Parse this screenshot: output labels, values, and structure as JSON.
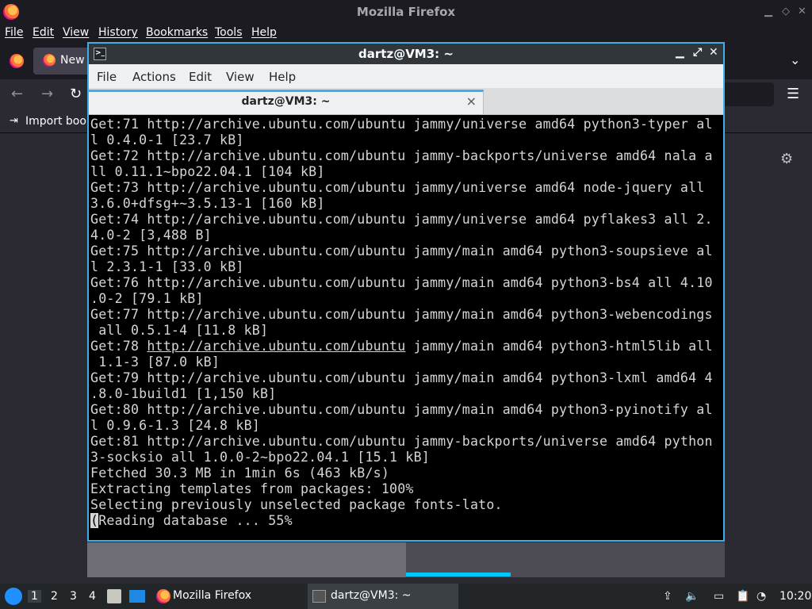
{
  "firefox": {
    "window_title": "Mozilla Firefox",
    "menu": [
      "File",
      "Edit",
      "View",
      "History",
      "Bookmarks",
      "Tools",
      "Help"
    ],
    "tab_label": "New",
    "bookmarks_import": "Import book",
    "settings_icon": "gear-icon"
  },
  "terminal": {
    "window_title": "dartz@VM3: ~",
    "menu": [
      "File",
      "Actions",
      "Edit",
      "View",
      "Help"
    ],
    "tab_title": "dartz@VM3: ~",
    "lines": [
      "Get:71 http://archive.ubuntu.com/ubuntu jammy/universe amd64 python3-typer al",
      "l 0.4.0-1 [23.7 kB]",
      "Get:72 http://archive.ubuntu.com/ubuntu jammy-backports/universe amd64 nala a",
      "ll 0.11.1~bpo22.04.1 [104 kB]",
      "Get:73 http://archive.ubuntu.com/ubuntu jammy/universe amd64 node-jquery all",
      "3.6.0+dfsg+~3.5.13-1 [160 kB]",
      "Get:74 http://archive.ubuntu.com/ubuntu jammy/universe amd64 pyflakes3 all 2.",
      "4.0-2 [3,488 B]",
      "Get:75 http://archive.ubuntu.com/ubuntu jammy/main amd64 python3-soupsieve al",
      "l 2.3.1-1 [33.0 kB]",
      "Get:76 http://archive.ubuntu.com/ubuntu jammy/main amd64 python3-bs4 all 4.10",
      ".0-2 [79.1 kB]",
      "Get:77 http://archive.ubuntu.com/ubuntu jammy/main amd64 python3-webencodings",
      " all 0.5.1-4 [11.8 kB]",
      "Get:78 ",
      " 1.1-3 [87.0 kB]",
      "Get:79 http://archive.ubuntu.com/ubuntu jammy/main amd64 python3-lxml amd64 4",
      ".8.0-1build1 [1,150 kB]",
      "Get:80 http://archive.ubuntu.com/ubuntu jammy/main amd64 python3-pyinotify al",
      "l 0.9.6-1.3 [24.8 kB]",
      "Get:81 http://archive.ubuntu.com/ubuntu jammy-backports/universe amd64 python",
      "3-socksio all 1.0.0-2~bpo22.04.1 [15.1 kB]",
      "Fetched 30.3 MB in 1min 6s (463 kB/s)",
      "Extracting templates from packages: 100%",
      "Selecting previously unselected package fonts-lato.",
      "Reading database ... 55%"
    ],
    "line78_link": "http://archive.ubuntu.com/ubuntu",
    "line78_rest": " jammy/main amd64 python3-html5lib all",
    "cursor_char": "("
  },
  "taskbar": {
    "workspaces": [
      "1",
      "2",
      "3",
      "4"
    ],
    "firefox_task": "Mozilla Firefox",
    "terminal_task": "dartz@VM3: ~",
    "clock": "10:20"
  }
}
